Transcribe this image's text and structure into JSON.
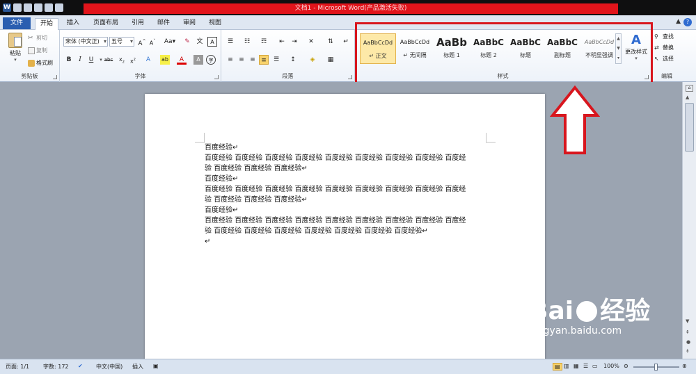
{
  "window": {
    "title": "文档1 - Microsoft Word(产品激活失败)"
  },
  "tabs": {
    "file": "文件",
    "items": [
      "开始",
      "插入",
      "页面布局",
      "引用",
      "邮件",
      "审阅",
      "视图"
    ]
  },
  "clipboard": {
    "paste": "粘贴",
    "cut": "剪切",
    "copy": "复制",
    "format_painter": "格式刷",
    "label": "剪贴板"
  },
  "font": {
    "font_name": "宋体 (中文正)",
    "font_size": "五号",
    "label": "字体"
  },
  "paragraph": {
    "label": "段落"
  },
  "styles": {
    "label": "样式",
    "items": [
      {
        "sample": "AaBbCcDd",
        "name": "↵ 正文"
      },
      {
        "sample": "AaBbCcDd",
        "name": "↵ 无间隔"
      },
      {
        "sample": "AaBb",
        "name": "标题 1"
      },
      {
        "sample": "AaBbC",
        "name": "标题 2"
      },
      {
        "sample": "AaBbC",
        "name": "标题"
      },
      {
        "sample": "AaBbC",
        "name": "副标题"
      },
      {
        "sample": "AaBbCcDd",
        "name": "不明显强调"
      }
    ],
    "change_styles": "更改样式"
  },
  "editing": {
    "find": "查找",
    "replace": "替换",
    "select": "选择",
    "label": "编辑"
  },
  "document": {
    "lines": [
      "百度经验↵",
      "百度经验 百度经验 百度经验 百度经验 百度经验 百度经验 百度经验 百度经验 百度经",
      "验 百度经验 百度经验 百度经验↵",
      "百度经验↵",
      "百度经验 百度经验 百度经验 百度经验 百度经验 百度经验 百度经验 百度经验 百度经",
      "验 百度经验 百度经验 百度经验↵",
      "百度经验↵",
      "百度经验 百度经验 百度经验 百度经验 百度经验 百度经验 百度经验 百度经验 百度经",
      "验 百度经验 百度经验 百度经验 百度经验 百度经验  百度经验 百度经验↵",
      "↵"
    ]
  },
  "status": {
    "page": "页面: 1/1",
    "words": "字数: 172",
    "language": "中文(中国)",
    "mode": "插入",
    "zoom": "100%"
  },
  "watermark": {
    "brand": "Bai",
    "brand2": "经验",
    "url": "jingyan.baidu.com"
  },
  "colors": {
    "highlight": "#d8161e",
    "title_bar": "#e1141b",
    "file_tab": "#2a5eb0"
  }
}
